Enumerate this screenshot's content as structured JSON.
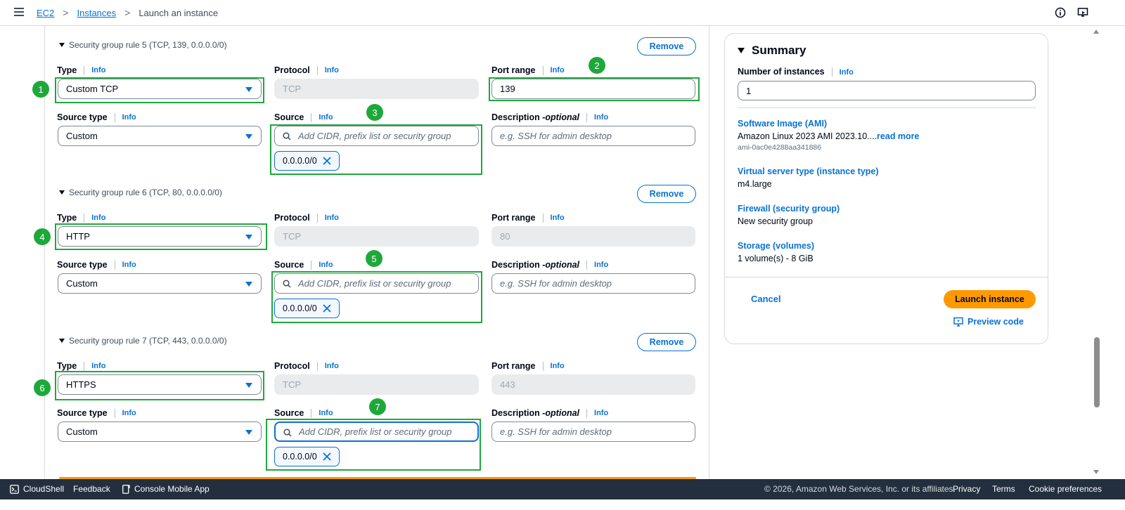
{
  "breadcrumb": {
    "root": "EC2",
    "section": "Instances",
    "current": "Launch an instance"
  },
  "labels": {
    "type": "Type",
    "protocol": "Protocol",
    "port_range": "Port range",
    "source_type": "Source type",
    "source": "Source",
    "description": "Description - ",
    "optional": "optional",
    "info": "Info",
    "remove": "Remove",
    "source_placeholder": "Add CIDR, prefix list or security group",
    "description_placeholder": "e.g. SSH for admin desktop"
  },
  "rules": [
    {
      "header": "Security group rule 5 (TCP, 139, 0.0.0.0/0)",
      "type": "Custom TCP",
      "protocol": "TCP",
      "port": "139",
      "source_type": "Custom",
      "token": "0.0.0.0/0"
    },
    {
      "header": "Security group rule 6 (TCP, 80, 0.0.0.0/0)",
      "type": "HTTP",
      "protocol": "TCP",
      "port": "80",
      "source_type": "Custom",
      "token": "0.0.0.0/0"
    },
    {
      "header": "Security group rule 7 (TCP, 443, 0.0.0.0/0)",
      "type": "HTTPS",
      "protocol": "TCP",
      "port": "443",
      "source_type": "Custom",
      "token": "0.0.0.0/0"
    }
  ],
  "badges": [
    "1",
    "2",
    "3",
    "4",
    "5",
    "6",
    "7"
  ],
  "highlight_color": "#1fa83a",
  "summary": {
    "title": "Summary",
    "num_label": "Number of instances",
    "info": "Info",
    "num_value": "1",
    "ami_label": "Software Image (AMI)",
    "ami_value": "Amazon Linux 2023 AMI 2023.10....",
    "ami_more": "read more",
    "ami_id": "ami-0ac0e4288aa341886",
    "type_label": "Virtual server type (instance type)",
    "type_value": "m4.large",
    "firewall_label": "Firewall (security group)",
    "firewall_value": "New security group",
    "storage_label": "Storage (volumes)",
    "storage_value": "1 volume(s) - 8 GiB",
    "cancel": "Cancel",
    "launch": "Launch instance",
    "preview": "Preview code"
  },
  "footer": {
    "cloudshell": "CloudShell",
    "feedback": "Feedback",
    "mobile": "Console Mobile App",
    "copyright": "© 2026, Amazon Web Services, Inc. or its affiliates.",
    "privacy": "Privacy",
    "terms": "Terms",
    "cookies": "Cookie preferences"
  },
  "colors": {
    "accent": "#0972d3",
    "launch": "#ff9900",
    "footer": "#232f3e"
  }
}
